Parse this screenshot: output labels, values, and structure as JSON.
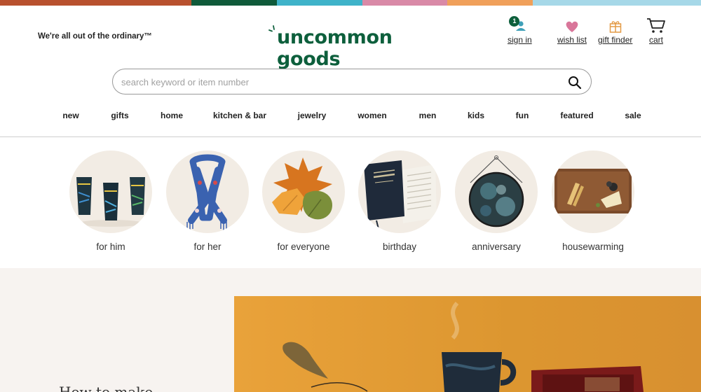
{
  "colors": {
    "stripe": [
      "#b8512e",
      "#0f5a3a",
      "#3fb3c9",
      "#d98aa7",
      "#f0a05a",
      "#a6d8e8"
    ],
    "brand": "#0d5f3c",
    "accent_pink": "#d9769a",
    "accent_orange": "#e9a23a"
  },
  "header": {
    "tagline": "We're all out of the ordinary™",
    "logo_text": "uncommon goods",
    "utility": [
      {
        "label": "sign in",
        "icon": "user-icon",
        "badge": "1"
      },
      {
        "label": "wish list",
        "icon": "heart-icon"
      },
      {
        "label": "gift finder",
        "icon": "gift-icon"
      },
      {
        "label": "cart",
        "icon": "cart-icon"
      }
    ]
  },
  "search": {
    "placeholder": "search keyword or item number",
    "value": "",
    "icon": "search-icon"
  },
  "nav": [
    "new",
    "gifts",
    "home",
    "kitchen & bar",
    "jewelry",
    "women",
    "men",
    "kids",
    "fun",
    "featured",
    "sale"
  ],
  "categories": [
    {
      "label": "for him",
      "image": "pint-glasses"
    },
    {
      "label": "for her",
      "image": "knit-scarf"
    },
    {
      "label": "for everyone",
      "image": "felt-leaves"
    },
    {
      "label": "birthday",
      "image": "birthday-book"
    },
    {
      "label": "anniversary",
      "image": "glass-pendant"
    },
    {
      "label": "housewarming",
      "image": "cheese-board"
    }
  ],
  "hero": {
    "headline_partial": "How to make"
  }
}
